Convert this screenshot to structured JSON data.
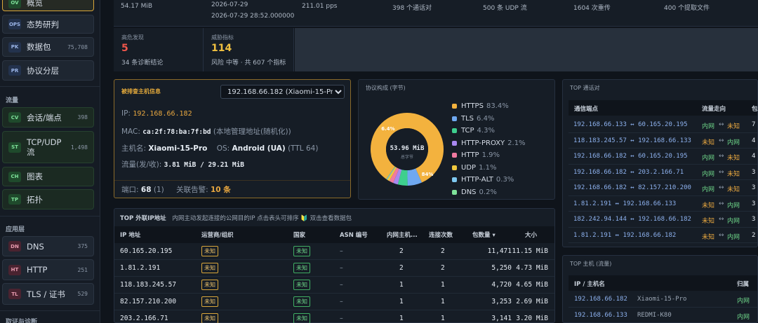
{
  "sidebar": {
    "top_items": [
      {
        "badge": "OV",
        "label": "概览",
        "count": ""
      },
      {
        "badge": "OPS",
        "label": "态势研判",
        "count": ""
      },
      {
        "badge": "PK",
        "label": "数据包",
        "count": "75,708"
      },
      {
        "badge": "PR",
        "label": "协议分层",
        "count": ""
      }
    ],
    "section_flow": "流量",
    "flow_items": [
      {
        "badge": "CV",
        "label": "会话/端点",
        "count": "398"
      },
      {
        "badge": "ST",
        "label": "TCP/UDP 流",
        "count": "1,498"
      },
      {
        "badge": "CH",
        "label": "图表",
        "count": ""
      },
      {
        "badge": "TP",
        "label": "拓扑",
        "count": ""
      }
    ],
    "section_app": "应用层",
    "app_items": [
      {
        "badge": "DN",
        "label": "DNS",
        "count": "375"
      },
      {
        "badge": "HT",
        "label": "HTTP",
        "count": "251"
      },
      {
        "badge": "TL",
        "label": "TLS / 证书",
        "count": "529"
      }
    ],
    "section_bottom": "取证与诊断"
  },
  "top_stats": [
    "54.17 MiB",
    "2026-07-29",
    "2026-07-29 28:52.000000",
    "211.01 pps",
    "398 个通话对",
    "500 条 UDP 流",
    "1604 次重传",
    "400 个提取文件"
  ],
  "stats": [
    {
      "title": "高危发现",
      "value": "5",
      "sub": "34 条诊断结论"
    },
    {
      "title": "威胁指标",
      "value": "114",
      "sub": "风险 中等 · 共 607 个指标"
    }
  ],
  "host": {
    "header": "被排查主机信息",
    "selected": "192.168.66.182 (Xiaomi-15-Pro)",
    "ip_label": "IP:",
    "ip": "192.168.66.182",
    "mac_label": "MAC:",
    "mac": "ca:2f:78:ba:7f:bd",
    "mac_note": "(本地管理地址(随机化))",
    "hostname_label": "主机名:",
    "hostname": "Xiaomi-15-Pro",
    "os_label": "OS:",
    "os": "Android (UA)",
    "os_note": "(TTL 64)",
    "traffic_label": "流量(发/收):",
    "traffic": "3.81 MiB / 29.21 MiB",
    "ports_label": "端口:",
    "ports": "68",
    "ports_note": "(1)",
    "alerts_label": "关联告警:",
    "alerts": "10 条"
  },
  "proto": {
    "header": "协议构成 (字节)",
    "center_value": "53.96 MiB",
    "center_label": "总字节",
    "labels_on_chart": [
      "6.4%",
      "84%"
    ],
    "legend": [
      {
        "name": "HTTPS",
        "pct": "83.4%",
        "color": "#f3b23e"
      },
      {
        "name": "TLS",
        "pct": "6.4%",
        "color": "#6fa8f0"
      },
      {
        "name": "TCP",
        "pct": "4.3%",
        "color": "#3ecf8e"
      },
      {
        "name": "HTTP-PROXY",
        "pct": "2.1%",
        "color": "#a888f0"
      },
      {
        "name": "HTTP",
        "pct": "1.9%",
        "color": "#f07aa0"
      },
      {
        "name": "UDP",
        "pct": "1.1%",
        "color": "#f0c83e"
      },
      {
        "name": "HTTP-ALT",
        "pct": "0.3%",
        "color": "#7ec8f0"
      },
      {
        "name": "DNS",
        "pct": "0.2%",
        "color": "#7ee29a"
      }
    ]
  },
  "chart_data": {
    "type": "pie",
    "title": "协议构成 (字节)",
    "categories": [
      "HTTPS",
      "TLS",
      "TCP",
      "HTTP-PROXY",
      "HTTP",
      "UDP",
      "HTTP-ALT",
      "DNS"
    ],
    "values": [
      83.4,
      6.4,
      4.3,
      2.1,
      1.9,
      1.1,
      0.3,
      0.2
    ]
  },
  "conv": {
    "header": "TOP 通话对",
    "col_endpoint": "通信端点",
    "col_dir": "流量走向",
    "col_more": "包",
    "rows": [
      {
        "pair": "192.168.66.133 ↔ 60.165.20.195",
        "a": "内网",
        "b": "未知",
        "n": "7"
      },
      {
        "pair": "118.183.245.57 ↔ 192.168.66.133",
        "a": "未知",
        "b": "内网",
        "n": "4"
      },
      {
        "pair": "192.168.66.182 ↔ 60.165.20.195",
        "a": "内网",
        "b": "未知",
        "n": "4"
      },
      {
        "pair": "192.168.66.182 ↔ 203.2.166.71",
        "a": "内网",
        "b": "未知",
        "n": "3"
      },
      {
        "pair": "192.168.66.182 ↔ 82.157.210.200",
        "a": "内网",
        "b": "未知",
        "n": "3"
      },
      {
        "pair": "1.81.2.191 ↔ 192.168.66.133",
        "a": "未知",
        "b": "内网",
        "n": "3"
      },
      {
        "pair": "182.242.94.144 ↔ 192.168.66.182",
        "a": "未知",
        "b": "内网",
        "n": "3"
      },
      {
        "pair": "1.81.2.191 ↔ 192.168.66.182",
        "a": "未知",
        "b": "内网",
        "n": "2"
      }
    ]
  },
  "hosts": {
    "header": "TOP 主机 (流量)",
    "col_ip": "IP / 主机名",
    "col_group": "归属",
    "rows": [
      {
        "ip": "192.168.66.182",
        "name": "Xiaomi-15-Pro",
        "group": "内网"
      },
      {
        "ip": "192.168.66.133",
        "name": "REDMI-K80",
        "group": "内网"
      }
    ]
  },
  "ext": {
    "header": "TOP 外联IP地址",
    "desc": "内网主动发起连接的公网目的IP 点击表头可排序 🔰 双击查看数据包",
    "cols": [
      "IP 地址",
      "运营商/组织",
      "国家",
      "ASN 编号",
      "内网主机...",
      "连接次数",
      "包数量 ▾",
      "大小"
    ],
    "rows": [
      {
        "ip": "60.165.20.195",
        "isp": "未知",
        "country": "未知",
        "asn": "–",
        "hosts": "2",
        "conns": "2",
        "pkts": "11,471",
        "size": "11.15 MiB"
      },
      {
        "ip": "1.81.2.191",
        "isp": "未知",
        "country": "未知",
        "asn": "–",
        "hosts": "2",
        "conns": "2",
        "pkts": "5,250",
        "size": "4.73 MiB"
      },
      {
        "ip": "118.183.245.57",
        "isp": "未知",
        "country": "未知",
        "asn": "–",
        "hosts": "1",
        "conns": "1",
        "pkts": "4,720",
        "size": "4.65 MiB"
      },
      {
        "ip": "82.157.210.200",
        "isp": "未知",
        "country": "未知",
        "asn": "–",
        "hosts": "1",
        "conns": "1",
        "pkts": "3,253",
        "size": "2.69 MiB"
      },
      {
        "ip": "203.2.166.71",
        "isp": "未知",
        "country": "未知",
        "asn": "–",
        "hosts": "1",
        "conns": "1",
        "pkts": "3,141",
        "size": "3.20 MiB"
      }
    ]
  }
}
